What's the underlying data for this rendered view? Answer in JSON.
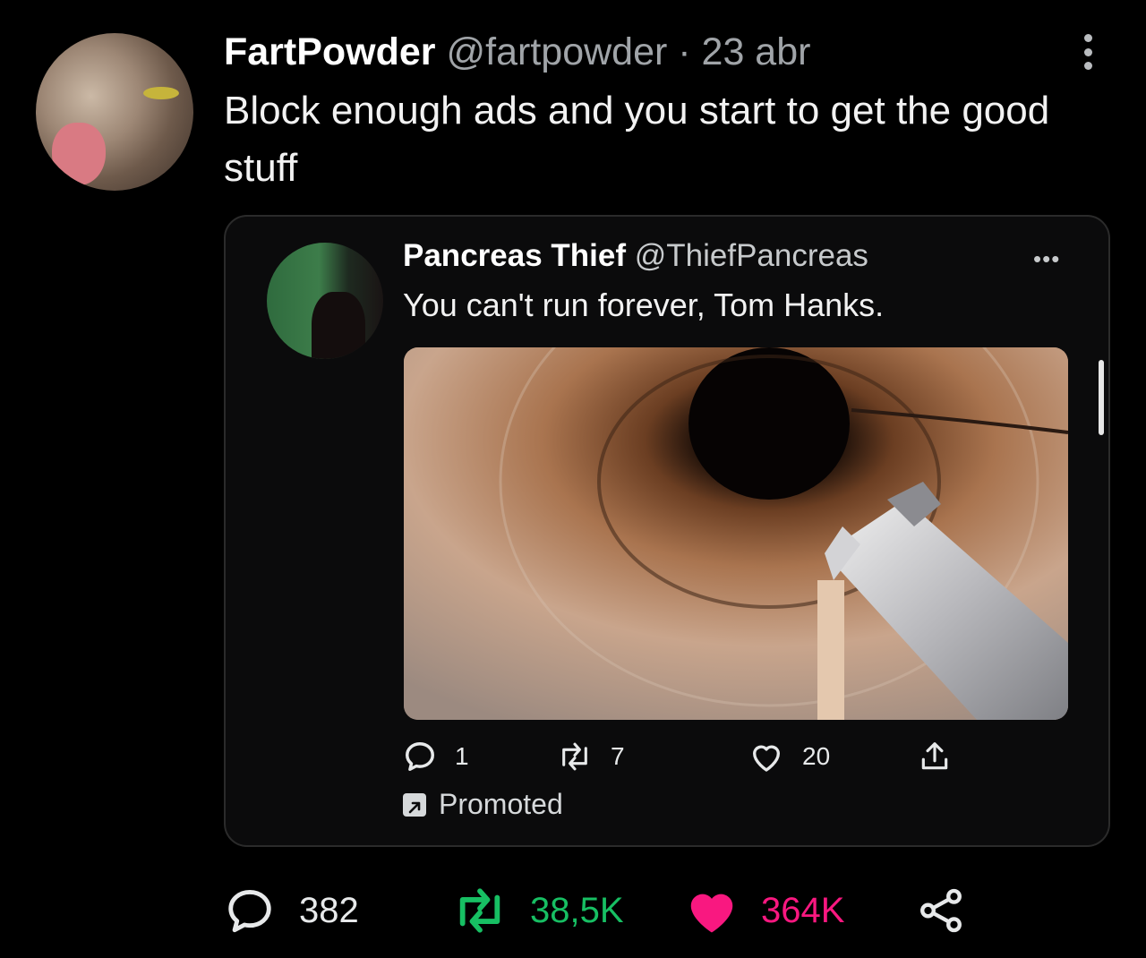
{
  "tweet": {
    "author_name": "FartPowder",
    "author_handle": "@fartpowder",
    "separator": " · ",
    "date": "23 abr",
    "text": "Block enough ads and you start to get the good stuff",
    "stats": {
      "replies": "382",
      "retweets": "38,5K",
      "likes": "364K"
    }
  },
  "quoted_tweet": {
    "author_name": "Pancreas Thief",
    "author_handle": "@ThiefPancreas",
    "text": "You can't run forever, Tom Hanks.",
    "stats": {
      "replies": "1",
      "retweets": "7",
      "likes": "20"
    },
    "promoted_label": "Promoted",
    "more_glyph": "•••"
  },
  "icons": {
    "reply": "reply-icon",
    "retweet": "retweet-icon",
    "like": "heart-icon",
    "share": "share-icon",
    "more": "more-icon",
    "promoted": "promoted-icon"
  },
  "colors": {
    "background": "#000000",
    "retweet_green": "#17bf63",
    "like_red": "#f91880"
  }
}
